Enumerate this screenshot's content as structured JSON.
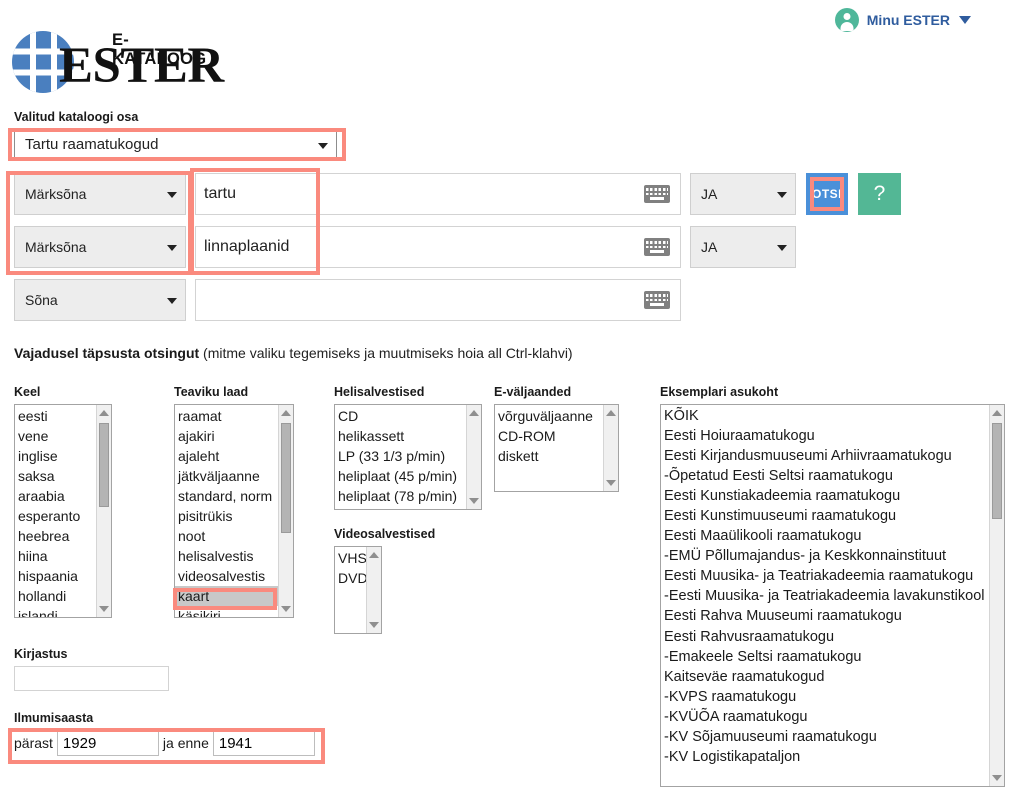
{
  "header": {
    "user_label": "Minu ESTER",
    "avatar_icon": "user-avatar-icon",
    "caret_icon": "chevron-down-icon",
    "logo_small": "E-KATALOOG",
    "logo_big": "ESTER"
  },
  "catalog": {
    "label": "Valitud kataloogi osa",
    "selected": "Tartu raamatukogud"
  },
  "search": {
    "rows": [
      {
        "index": "Märksõna",
        "term": "tartu",
        "bool": "JA",
        "keyboard_icon": "keyboard-icon"
      },
      {
        "index": "Märksõna",
        "term": "linnaplaanid",
        "bool": "JA",
        "keyboard_icon": "keyboard-icon"
      },
      {
        "index": "Sõna",
        "term": "",
        "bool": "",
        "keyboard_icon": "keyboard-icon"
      }
    ],
    "submit_label": "OTSI",
    "help_label": "?",
    "submit_color": "#4a90d9",
    "help_color": "#53b795",
    "highlight_color": "#fa8a7e"
  },
  "refine": {
    "heading_bold": "Vajadusel täpsusta otsingut",
    "heading_rest": " (mitme valiku tegemiseks ja muutmiseks hoia all Ctrl-klahvi)"
  },
  "lists": {
    "keel": {
      "label": "Keel",
      "items": [
        "eesti",
        "vene",
        "inglise",
        "saksa",
        "araabia",
        "esperanto",
        "heebrea",
        "hiina",
        "hispaania",
        "hollandi",
        "islandi"
      ],
      "selected": []
    },
    "teaviku_laad": {
      "label": "Teaviku laad",
      "items": [
        "raamat",
        "ajakiri",
        "ajaleht",
        "jätkväljaanne",
        "standard, norm",
        "pisitrükis",
        "noot",
        "helisalvestis",
        "videosalvestis",
        "kaart",
        "käsikiri"
      ],
      "selected": [
        "kaart"
      ]
    },
    "helisalvestised": {
      "label": "Helisalvestised",
      "items": [
        "CD",
        "helikassett",
        "LP (33 1/3 p/min)",
        "heliplaat (45 p/min)",
        "heliplaat (78 p/min)"
      ],
      "selected": []
    },
    "e_valjaanded": {
      "label": "E-väljaanded",
      "items": [
        "võrguväljaanne",
        "CD-ROM",
        "diskett"
      ],
      "selected": []
    },
    "videosalvestised": {
      "label": "Videosalvestised",
      "items": [
        "VHS",
        "DVD"
      ],
      "selected": []
    },
    "eksemplari_asukoht": {
      "label": "Eksemplari asukoht",
      "items": [
        "KÕIK",
        "Eesti Hoiuraamatukogu",
        "Eesti Kirjandusmuuseumi Arhiivraamatukogu",
        "-Õpetatud Eesti Seltsi raamatukogu",
        "Eesti Kunstiakadeemia raamatukogu",
        "Eesti Kunstimuuseumi raamatukogu",
        "Eesti Maaülikooli raamatukogu",
        "-EMÜ Põllumajandus- ja Keskkonnainstituut",
        "Eesti Muusika- ja Teatriakadeemia raamatukogu",
        "-Eesti Muusika- ja Teatriakadeemia lavakunstikool",
        "Eesti Rahva Muuseumi raamatukogu",
        "Eesti Rahvusraamatukogu",
        "-Emakeele Seltsi raamatukogu",
        "Kaitseväe raamatukogud",
        "-KVPS raamatukogu",
        "-KVÜÕA raamatukogu",
        "-KV Sõjamuuseumi raamatukogu",
        "-KV Logistikapataljon"
      ],
      "selected": []
    }
  },
  "publisher": {
    "label": "Kirjastus",
    "value": ""
  },
  "year": {
    "label": "Ilmumisaasta",
    "after_label": "pärast",
    "after_value": "1929",
    "before_label": "ja enne",
    "before_value": "1941"
  }
}
